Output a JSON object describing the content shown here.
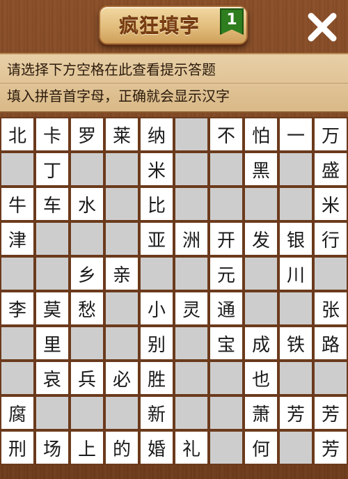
{
  "app": {
    "title": "疯狂填字",
    "level": "1",
    "close_icon": "close-icon"
  },
  "hint": {
    "line1": "请选择下方空格在此查看提示答题",
    "line2": "填入拼音首字母，正确就会显示汉字"
  },
  "grid": {
    "rows": [
      [
        "北",
        "卡",
        "罗",
        "莱",
        "纳",
        null,
        "不",
        "怕",
        "一",
        "万"
      ],
      [
        null,
        "丁",
        null,
        null,
        "米",
        null,
        null,
        "黑",
        null,
        "盛"
      ],
      [
        "牛",
        "车",
        "水",
        null,
        "比",
        null,
        null,
        null,
        null,
        "米"
      ],
      [
        "津",
        null,
        null,
        null,
        "亚",
        "洲",
        "开",
        "发",
        "银",
        "行"
      ],
      [
        null,
        null,
        "乡",
        "亲",
        null,
        null,
        "元",
        null,
        "川",
        null
      ],
      [
        "李",
        "莫",
        "愁",
        null,
        "小",
        "灵",
        "通",
        null,
        null,
        "张"
      ],
      [
        null,
        "里",
        null,
        null,
        "别",
        null,
        "宝",
        "成",
        "铁",
        "路"
      ],
      [
        null,
        "哀",
        "兵",
        "必",
        "胜",
        null,
        null,
        "也",
        null,
        null
      ],
      [
        "腐",
        null,
        null,
        null,
        "新",
        null,
        null,
        "萧",
        "芳",
        "芳"
      ],
      [
        "刑",
        "场",
        "上",
        "的",
        "婚",
        "礼",
        null,
        "何",
        null,
        "芳"
      ]
    ],
    "white_mask": [
      [
        1,
        1,
        1,
        1,
        1,
        0,
        1,
        1,
        1,
        1
      ],
      [
        0,
        1,
        0,
        0,
        1,
        0,
        0,
        1,
        0,
        1
      ],
      [
        1,
        1,
        1,
        0,
        1,
        0,
        0,
        0,
        0,
        1
      ],
      [
        1,
        0,
        0,
        0,
        1,
        1,
        1,
        1,
        1,
        1
      ],
      [
        0,
        0,
        1,
        1,
        0,
        0,
        1,
        0,
        1,
        0
      ],
      [
        1,
        1,
        1,
        0,
        1,
        1,
        1,
        0,
        0,
        1
      ],
      [
        0,
        1,
        0,
        0,
        1,
        0,
        1,
        1,
        1,
        1
      ],
      [
        0,
        1,
        1,
        1,
        1,
        0,
        0,
        1,
        0,
        0
      ],
      [
        1,
        0,
        0,
        0,
        1,
        0,
        0,
        1,
        1,
        1
      ],
      [
        1,
        1,
        1,
        1,
        1,
        1,
        0,
        1,
        0,
        1
      ]
    ]
  }
}
